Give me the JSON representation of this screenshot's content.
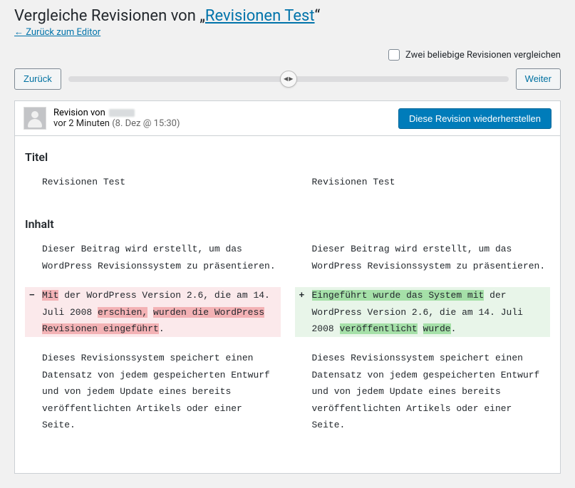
{
  "heading_prefix": "Vergleiche Revisionen von „",
  "heading_link": "Revisionen Test",
  "heading_suffix": "“",
  "back_to_editor": "← Zurück zum Editor",
  "compare_any_label": "Zwei beliebige Revisionen vergleichen",
  "nav": {
    "prev": "Zurück",
    "next": "Weiter"
  },
  "meta": {
    "revision_by": "Revision von",
    "time_ago": "vor 2 Minuten",
    "date": "(8. Dez @ 15:30)"
  },
  "restore_label": "Diese Revision wiederherstellen",
  "sections": {
    "title_label": "Titel",
    "content_label": "Inhalt"
  },
  "title": {
    "left": "Revisionen Test",
    "right": "Revisionen Test"
  },
  "content": {
    "left": {
      "p1": "Dieser Beitrag wird erstellt, um das WordPress Revisionssystem zu präsentieren.",
      "p2_del1": "Mit",
      "p2_mid1": " der WordPress Version 2.6, die am 14. Juli 2008 ",
      "p2_del2": "erschien,",
      "p2_sp": " ",
      "p2_del3": "wurden die WordPress Revisionen eingeführt",
      "p2_end": ".",
      "p3": "Dieses Revisionssystem speichert einen Datensatz von jedem gespeicherten Entwurf und von jedem Update eines bereits veröffentlichten Artikels oder einer Seite."
    },
    "right": {
      "p1": "Dieser Beitrag wird erstellt, um das WordPress Revisionssystem zu präsentieren.",
      "p2_ins1": "Eingeführt wurde das System mit",
      "p2_mid1": " der WordPress Version 2.6, die am 14. Juli 2008 ",
      "p2_ins2": "veröffentlicht",
      "p2_sp": " ",
      "p2_ins3": "wurde",
      "p2_end": ".",
      "p3": "Dieses Revisionssystem speichert einen Datensatz von jedem gespeicherten Entwurf und von jedem Update eines bereits veröffentlichten Artikels oder einer Seite."
    }
  },
  "markers": {
    "minus": "−",
    "plus": "+"
  }
}
